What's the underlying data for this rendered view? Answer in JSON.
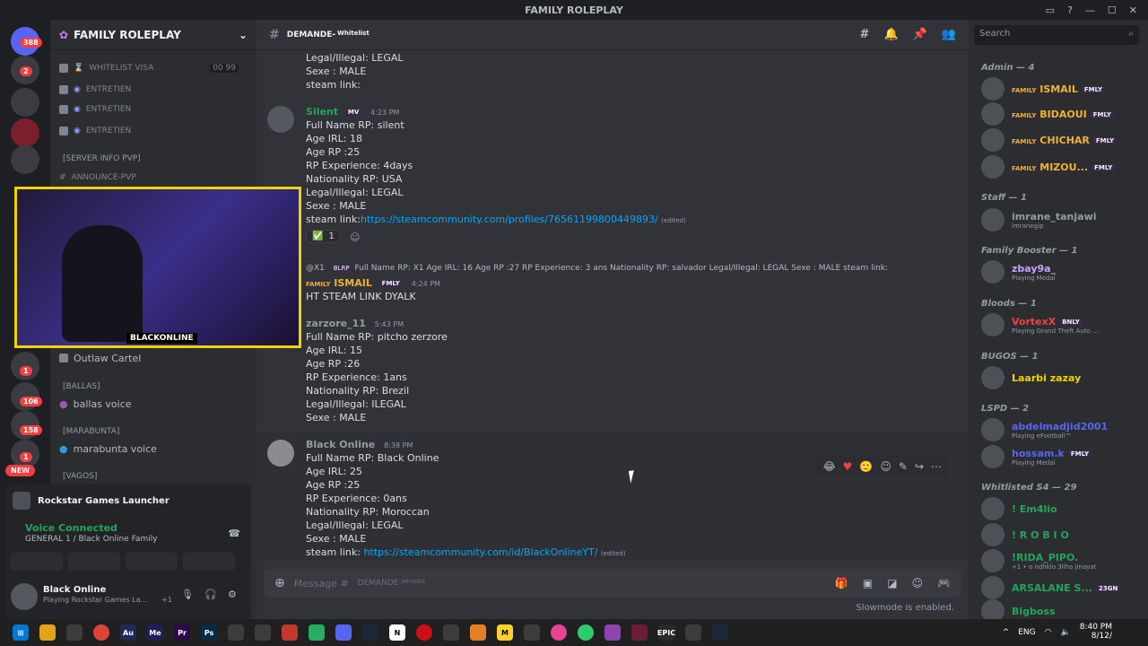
{
  "window": {
    "title": "FAMILY ROLEPLAY"
  },
  "guilds": {
    "badges": [
      "388",
      "2",
      "1",
      "106",
      "158",
      "1"
    ],
    "new_label": "NEW"
  },
  "server": {
    "name": "FAMILY ROLEPLAY"
  },
  "channels": {
    "items": [
      {
        "label": "WHITELIST VISA",
        "counts": "00  99"
      },
      {
        "label": "ENTRETIEN"
      },
      {
        "label": "ENTRETIEN"
      },
      {
        "label": "ENTRETIEN"
      }
    ],
    "cat_server_info": "[SERVER INFO PVP]",
    "announce": "ANNOUNCE-PVP",
    "outlaw": "Outlaw Cartel",
    "cat_ballas": "[BALLAS]",
    "ballas_voice": "ballas voice",
    "cat_marabunta": "[MARABUNTA]",
    "marabunta_voice": "marabunta voice",
    "cat_vagos": "[VAGOS]"
  },
  "webcam": {
    "label": "BLACKONLINE"
  },
  "activity": {
    "title": "Rockstar Games Launcher"
  },
  "voice": {
    "status": "Voice Connected",
    "channel": "GENERAL 1 / Black Online Family"
  },
  "user": {
    "name": "Black Online",
    "status": "Playing Rockstar Games La...",
    "extra": "+1"
  },
  "chat": {
    "channel": "DEMANDE-",
    "channel_suffix": "Whitelist",
    "top_lines": [
      "Legal/Illegal: LEGAL",
      "Sexe : MALE",
      "steam link:"
    ],
    "messages": [
      {
        "author": "Silent",
        "author_color": "#23a55a",
        "tag": "MV",
        "time": "4:23 PM",
        "lines": [
          "Full Name RP: silent",
          "Age IRL: 18",
          "Age RP :25",
          "RP Experience: 4days",
          "Nationality RP: USA",
          "Legal/Illegal: LEGAL",
          "Sexe : MALE"
        ],
        "link_prefix": "steam link:",
        "link": "https://steamcommunity.com/profiles/76561199800449893/",
        "edited": "(edited)",
        "reaction_count": "1"
      },
      {
        "reply_author": "@X1",
        "reply_tag": "BLRP",
        "reply_text": "Full Name RP: X1 Age IRL: 16 Age RP :27 RP Experience: 3 ans Nationality RP: salvador Legal/Illegal: LEGAL Sexe : MALE steam link:",
        "author": "ISMAIL",
        "author_prefix": "FAMILY",
        "author_color": "#f0b232",
        "tag": "FMLY",
        "time": "4:24 PM",
        "lines": [
          "HT STEAM LINK DYALK"
        ]
      },
      {
        "author": "zarzore_11",
        "author_color": "#949ba4",
        "time": "5:43 PM",
        "lines": [
          "Full Name RP: pitcho zerzore",
          "Age IRL: 15",
          "Age RP :26",
          "RP Experience: 1ans",
          "Nationality RP: Brezil",
          "Legal/Illegal: ILEGAL",
          "Sexe : MALE"
        ]
      },
      {
        "author": "Black Online",
        "author_color": "#949ba4",
        "time": "8:38 PM",
        "lines": [
          "Full Name RP: Black Online",
          "Age IRL: 25",
          "Age RP :25",
          "RP Experience: 0ans",
          "Nationality RP: Moroccan",
          "Legal/Illegal: LEGAL",
          "Sexe : MALE"
        ],
        "link_prefix": "steam link:",
        "link": "https://steamcommunity.com/id/BlackOnlineYT/",
        "edited": "(edited)"
      }
    ],
    "composer_placeholder": "Message #",
    "composer_channel": "DEMANDE-",
    "composer_suffix": "Whitelist",
    "slowmode": "Slowmode is enabled."
  },
  "search": {
    "placeholder": "Search"
  },
  "members": {
    "groups": [
      {
        "title": "Admin — 4",
        "members": [
          {
            "prefix": "FAMILY",
            "name": "ISMAIL",
            "tag": "FMLY",
            "color": "#f0b232"
          },
          {
            "prefix": "FAMILY",
            "name": "BIDAOUI",
            "tag": "FMLY",
            "color": "#f0b232"
          },
          {
            "prefix": "FAMILY",
            "name": "CHICHAR",
            "tag": "FMLY",
            "color": "#f0b232"
          },
          {
            "prefix": "FAMILY",
            "name": "MIZOU...",
            "tag": "FMLY",
            "color": "#f0b232"
          }
        ]
      },
      {
        "title": "Staff — 1",
        "members": [
          {
            "name": "imrane_tanjawi",
            "sub": "imranegip",
            "color": "#949ba4"
          }
        ]
      },
      {
        "title": "Family Booster — 1",
        "members": [
          {
            "name": "zbay9a_",
            "sub": "Playing Medal",
            "color": "#c9a0ff"
          }
        ]
      },
      {
        "title": "Bloods — 1",
        "members": [
          {
            "name": "VortexX",
            "tag": "BNLY",
            "sub": "Playing Grand Theft Auto ...",
            "color": "#f23f43"
          }
        ]
      },
      {
        "title": "BUGOS — 1",
        "members": [
          {
            "name": "Laarbi zazay",
            "color": "#f0d300"
          }
        ]
      },
      {
        "title": "LSPD — 2",
        "members": [
          {
            "name": "abdelmadjid2001",
            "sub": "Playing eFootball™",
            "color": "#5865f2"
          },
          {
            "name": "hossam.k",
            "tag": "FMLY",
            "sub": "Playing Medal",
            "color": "#5865f2"
          }
        ]
      },
      {
        "title": "Whitlisted S4 — 29",
        "members": [
          {
            "name": "! Em4lio",
            "color": "#23a55a"
          },
          {
            "name": "! R O B I O",
            "color": "#23a55a"
          },
          {
            "name": "!RIDA_PIPO.",
            "sub": "+1 • o ndhklo 3liha jinayat",
            "color": "#23a55a"
          },
          {
            "name": "ARSALANE S...",
            "tag": "23GN",
            "color": "#23a55a"
          },
          {
            "name": "Bigboss",
            "color": "#23a55a"
          }
        ]
      }
    ]
  },
  "taskbar": {
    "lang": "ENG",
    "time": "8:40 PM",
    "date": "8/12/"
  }
}
